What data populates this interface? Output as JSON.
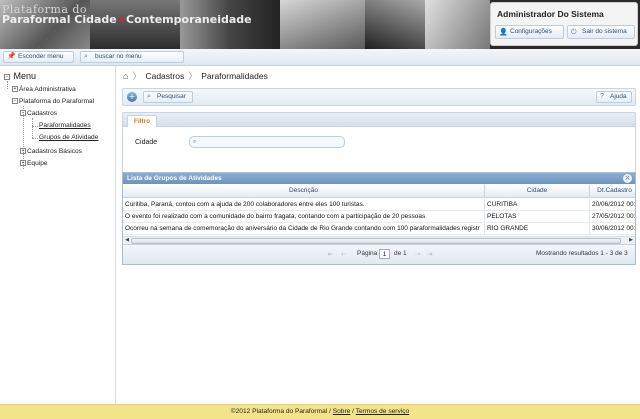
{
  "header": {
    "logo_line1": "Plataforma do",
    "logo_line2_a": "Paraformal ",
    "logo_line2_b": "Cidade",
    "logo_line2_plus": "+",
    "logo_line2_c": "Contemporaneidade",
    "user_name": "Administrador Do Sistema",
    "config_label": "Configurações",
    "logout_label": "Sair do sistema"
  },
  "topbar": {
    "hide_menu_label": "Esconder menu",
    "search_menu_label": "buscar no menu"
  },
  "sidebar": {
    "title": "Menu",
    "items": [
      {
        "label": "Área Administrativa",
        "toggle": "+"
      },
      {
        "label": "Plataforma do Paraformal",
        "toggle": "−"
      },
      {
        "label": "Cadastros",
        "toggle": "−"
      },
      {
        "label": "Paraformalidades"
      },
      {
        "label": "Grupos de Atividade"
      },
      {
        "label": "Cadastros Básicos",
        "toggle": "+"
      },
      {
        "label": "Equipe",
        "toggle": "+"
      }
    ]
  },
  "breadcrumb": {
    "items": [
      "Cadastros",
      "Paraformalidades"
    ]
  },
  "toolbar": {
    "add_symbol": "+",
    "search_label": "Pesquisar",
    "help_label": "Ajuda"
  },
  "filter": {
    "tab_label": "Filtro",
    "city_label": "Cidade",
    "city_value": ""
  },
  "grid": {
    "title": "Lista de Grupos de Atividades",
    "columns": [
      "Descrição",
      "Cidade",
      "Dt.Cadastro"
    ],
    "rows": [
      [
        "Curitiba, Paraná, contou com a ajuda de 200 colaboradores entre eles 100 turistas.",
        "CURITIBA",
        "20/06/2012 00:0"
      ],
      [
        "O evento foi realizado com a comunidade do bairro fragata, contando com a participação de 20 pessoas",
        "PELOTAS",
        "27/05/2012 00:0"
      ],
      [
        "Ocorreu na semana de comemoração do aniversário da Cidade de Rio Grande contando com 100 paraformalidades registr",
        "RIO GRANDE",
        "30/06/2012 00:0"
      ]
    ],
    "pager": {
      "page_label": "Página",
      "page_value": "1",
      "of_label": "de 1",
      "results_label": "Mostrando resultados 1 - 3 de 3"
    }
  },
  "footer": {
    "text": "©2012 Plataforma do Paraformal / ",
    "about_link": "Sobre",
    "sep": " / ",
    "terms_link": "Termos de serviço"
  },
  "colors": {
    "accent": "#2a4d77",
    "filter_tab": "#e07a16",
    "footer_bg": "#f3e48a",
    "logo_plus": "#d9242a"
  }
}
